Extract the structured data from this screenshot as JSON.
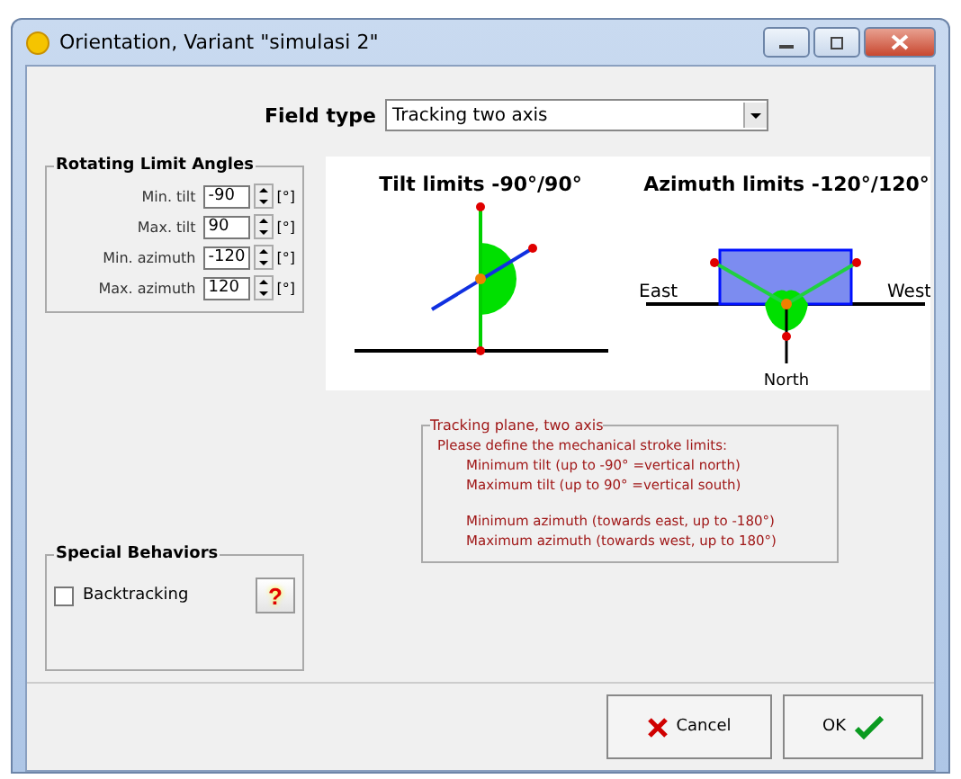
{
  "window": {
    "title": "Orientation, Variant \"simulasi 2\""
  },
  "field_type": {
    "label": "Field type",
    "value": "Tracking two axis"
  },
  "rotating_limits": {
    "title": "Rotating Limit Angles",
    "rows": [
      {
        "label": "Min. tilt",
        "value": "-90",
        "unit": "[°]"
      },
      {
        "label": "Max. tilt",
        "value": "90",
        "unit": "[°]"
      },
      {
        "label": "Min. azimuth",
        "value": "-120",
        "unit": "[°]"
      },
      {
        "label": "Max. azimuth",
        "value": "120",
        "unit": "[°]"
      }
    ]
  },
  "diagram": {
    "tilt_title": "Tilt limits -90°/90°",
    "azimuth_title": "Azimuth limits -120°/120°",
    "east": "East",
    "west": "West",
    "north": "North"
  },
  "info": {
    "title": "Tracking plane, two axis",
    "intro": "Please define the mechanical stroke limits:",
    "groups": [
      [
        "Minimum tilt  (up to -90° =vertical north)",
        "Maximum tilt  (up to 90° =vertical south)"
      ],
      [
        "Minimum azimuth (towards east, up to -180°)",
        "Maximum azimuth (towards west, up to 180°)"
      ]
    ]
  },
  "special": {
    "title": "Special Behaviors",
    "backtracking": {
      "label": "Backtracking",
      "checked": false
    },
    "help": "?"
  },
  "buttons": [
    {
      "kind": "cancel",
      "label": "Cancel"
    },
    {
      "kind": "ok",
      "label": "OK"
    }
  ]
}
